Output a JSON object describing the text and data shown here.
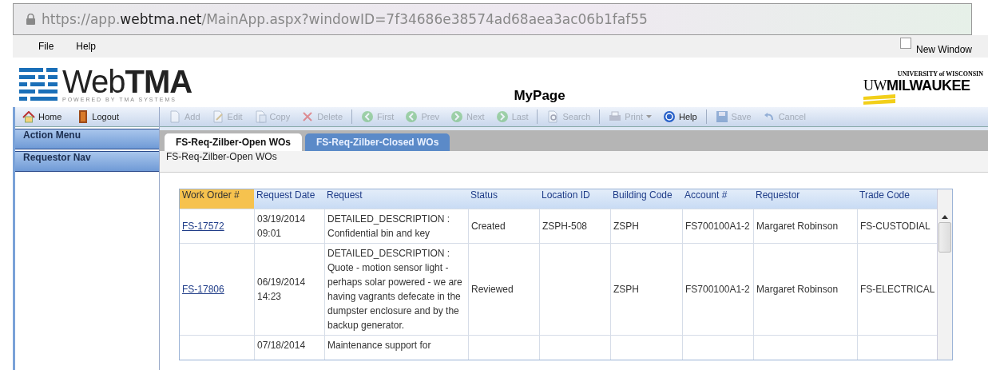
{
  "address_bar": {
    "url_prefix": "https://app.",
    "url_domain": "webtma.net",
    "url_rest": "/MainApp.aspx?windowID=7f34686e38574ad68aea3ac06b1faf55"
  },
  "menu": [
    {
      "label": "File"
    },
    {
      "label": "Help"
    }
  ],
  "new_window": {
    "label": "New Window",
    "checked": false
  },
  "logo": {
    "light": "Web",
    "bold": "TMA",
    "tagline": "POWERED BY TMA SYSTEMS"
  },
  "page_title": "MyPage",
  "university_logo": {
    "top": "UNIVERSITY of WISCONSIN",
    "uw": "UW",
    "name": "MILWAUKEE"
  },
  "nav_toolbar": [
    {
      "label": "Home"
    },
    {
      "label": "Logout"
    }
  ],
  "toolbar": {
    "groups": [
      [
        {
          "label": "Add",
          "disabled": true
        },
        {
          "label": "Edit",
          "disabled": true
        },
        {
          "label": "Copy",
          "disabled": true
        },
        {
          "label": "Delete",
          "disabled": true
        }
      ],
      [
        {
          "label": "First",
          "disabled": true
        },
        {
          "label": "Prev",
          "disabled": true
        },
        {
          "label": "Next",
          "disabled": true
        },
        {
          "label": "Last",
          "disabled": true
        }
      ],
      [
        {
          "label": "Search",
          "disabled": true
        }
      ],
      [
        {
          "label": "Print",
          "disabled": true
        },
        {
          "label": "Help",
          "disabled": false
        }
      ],
      [
        {
          "label": "Save",
          "disabled": true
        },
        {
          "label": "Cancel",
          "disabled": true
        }
      ]
    ]
  },
  "sidebar": {
    "items": [
      {
        "label": "Action Menu"
      },
      {
        "label": "Requestor Nav"
      }
    ]
  },
  "tabs": [
    {
      "label": "FS-Req-Zilber-Open WOs",
      "selected": true
    },
    {
      "label": "FS-Req-Zilber-Closed WOs",
      "selected": false
    }
  ],
  "panel_title": "FS-Req-Zilber-Open WOs",
  "table": {
    "columns": [
      {
        "label": "Work Order #",
        "sorted": true
      },
      {
        "label": "Request Date",
        "sorted": false
      },
      {
        "label": "Request",
        "sorted": false
      },
      {
        "label": "Status",
        "sorted": false
      },
      {
        "label": "Location ID",
        "sorted": false
      },
      {
        "label": "Building Code",
        "sorted": false
      },
      {
        "label": "Account #",
        "sorted": false
      },
      {
        "label": "Requestor",
        "sorted": false
      },
      {
        "label": "Trade Code",
        "sorted": false
      }
    ],
    "rows": [
      [
        "FS-17572",
        "03/19/2014 09:01",
        "DETAILED_DESCRIPTION : Confidential bin and key",
        "Created",
        "ZSPH-508",
        "ZSPH",
        "FS700100A1-2",
        "Margaret Robinson",
        "FS-CUSTODIAL"
      ],
      [
        "FS-17806",
        "06/19/2014 14:23",
        "DETAILED_DESCRIPTION : Quote - motion sensor light - perhaps solar powered - we are having vagrants defecate in the dumpster enclosure and by the backup generator.",
        "Reviewed",
        "",
        "ZSPH",
        "FS700100A1-2",
        "Margaret Robinson",
        "FS-ELECTRICAL"
      ],
      [
        "",
        "07/18/2014",
        "Maintenance support for",
        "",
        "",
        "",
        "",
        "",
        ""
      ]
    ]
  }
}
